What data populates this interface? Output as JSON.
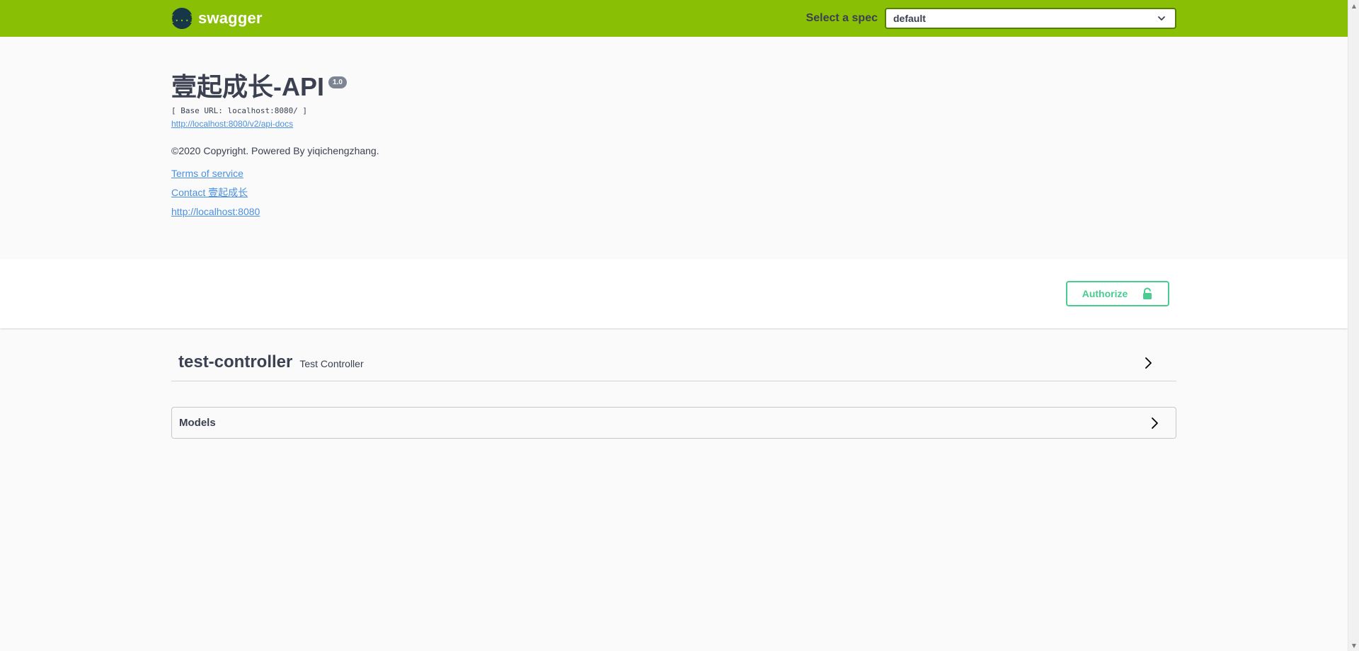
{
  "topbar": {
    "brand_logo": "{...}",
    "brand_name": "swagger",
    "spec_label": "Select a spec",
    "spec_selected": "default",
    "background_color": "#89bf04"
  },
  "info": {
    "title": "壹起成长-API",
    "version": "1.0",
    "base_url": "[ Base URL: localhost:8080/ ]",
    "docs_link": "http://localhost:8080/v2/api-docs",
    "description": "©2020 Copyright. Powered By yiqichengzhang.",
    "links": {
      "terms": "Terms of service",
      "contact": "Contact 壹起成长",
      "website": "http://localhost:8080"
    }
  },
  "authorize": {
    "label": "Authorize",
    "icon": "lock-icon",
    "color": "#49cc90"
  },
  "tags": [
    {
      "name": "test-controller",
      "description": "Test Controller",
      "icon": "chevron-right-icon"
    }
  ],
  "models": {
    "title": "Models",
    "icon": "chevron-right-icon"
  }
}
